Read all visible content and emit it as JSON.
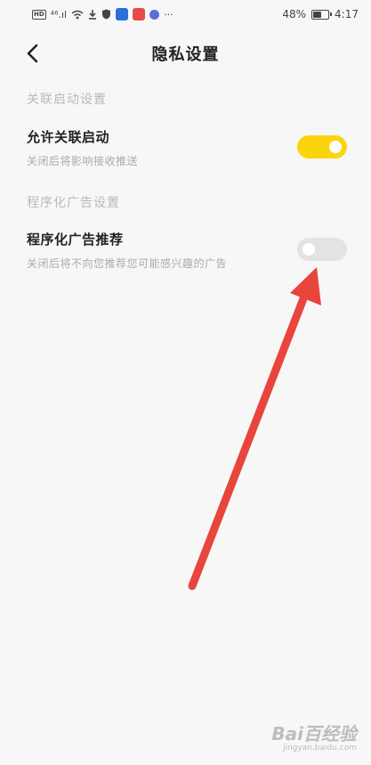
{
  "status_bar": {
    "hd": "HD",
    "signal": "⁴⁶.ıl",
    "more": "···",
    "battery_text": "48%",
    "battery_level": 0.48,
    "time": "4:17"
  },
  "header": {
    "title": "隐私设置",
    "back_icon": "chevron-left-icon"
  },
  "sections": {
    "association": {
      "title": "关联启动设置",
      "item_title": "允许关联启动",
      "item_desc": "关闭后将影响接收推送",
      "toggle_on": true
    },
    "ads": {
      "title": "程序化广告设置",
      "item_title": "程序化广告推荐",
      "item_desc": "关闭后将不向您推荐您可能感兴趣的广告",
      "toggle_on": false
    }
  },
  "colors": {
    "toggle_on": "#fcd40e",
    "toggle_off": "#e3e3e3",
    "arrow": "#e8453c"
  },
  "watermark": {
    "main": "Bai百经验",
    "sub": "jingyan.baidu.com"
  }
}
